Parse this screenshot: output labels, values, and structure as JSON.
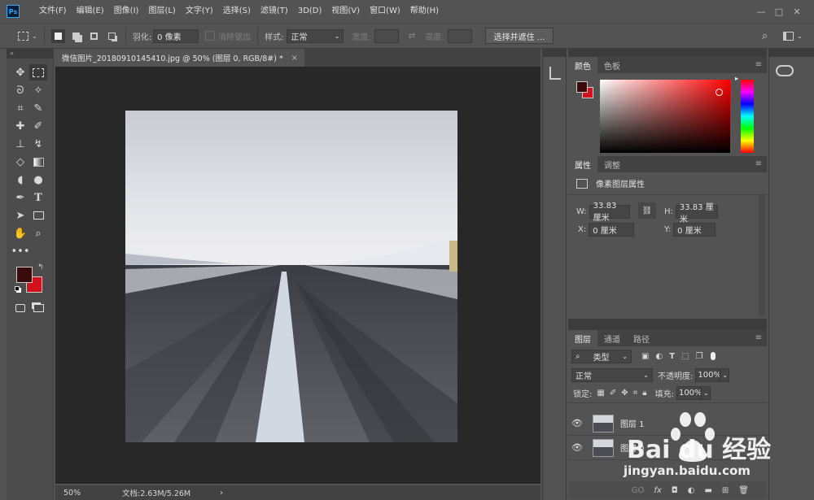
{
  "app": {
    "logo": "Ps"
  },
  "menus": [
    "文件(F)",
    "编辑(E)",
    "图像(I)",
    "图层(L)",
    "文字(Y)",
    "选择(S)",
    "滤镜(T)",
    "3D(D)",
    "视图(V)",
    "窗口(W)",
    "帮助(H)"
  ],
  "window_controls": [
    "—",
    "□",
    "✕"
  ],
  "options": {
    "feather_label": "羽化:",
    "feather_value": "0 像素",
    "antialias_label": "消除锯齿",
    "style_label": "样式:",
    "style_value": "正常",
    "width_label": "宽度:",
    "height_label": "高度:",
    "select_mask_button": "选择并遮住 ..."
  },
  "document": {
    "tab_title": "微信图片_20180910145410.jpg @ 50% (图层 0, RGB/8#) *",
    "close": "×",
    "zoom": "50%",
    "doc_info": "文档:2.63M/5.26M",
    "status_arrow": "›"
  },
  "color_panel": {
    "tabs": [
      "颜色",
      "色板"
    ],
    "fg_color": "#3b0b0b",
    "bg_color": "#d0121b",
    "picker_hue": "#ff0000"
  },
  "properties_panel": {
    "tabs": [
      "属性",
      "调整"
    ],
    "title": "像素图层属性",
    "w_label": "W:",
    "w_value": "33.83 厘米",
    "h_label": "H:",
    "h_value": "33.83 厘米",
    "x_label": "X:",
    "x_value": "0 厘米",
    "y_label": "Y:",
    "y_value": "0 厘米"
  },
  "layers_panel": {
    "tabs": [
      "图层",
      "通道",
      "路径"
    ],
    "filter_kind": "类型",
    "blend_mode": "正常",
    "opacity_label": "不透明度:",
    "opacity_value": "100%",
    "lock_label": "锁定:",
    "fill_label": "填充:",
    "fill_value": "100%",
    "layers": [
      {
        "name": "图层 1"
      },
      {
        "name": "图层 0"
      }
    ],
    "bottom_icons": [
      "GO",
      "fx"
    ]
  },
  "watermark": {
    "brand": "Bai du 经验",
    "url": "jingyan.baidu.com"
  }
}
